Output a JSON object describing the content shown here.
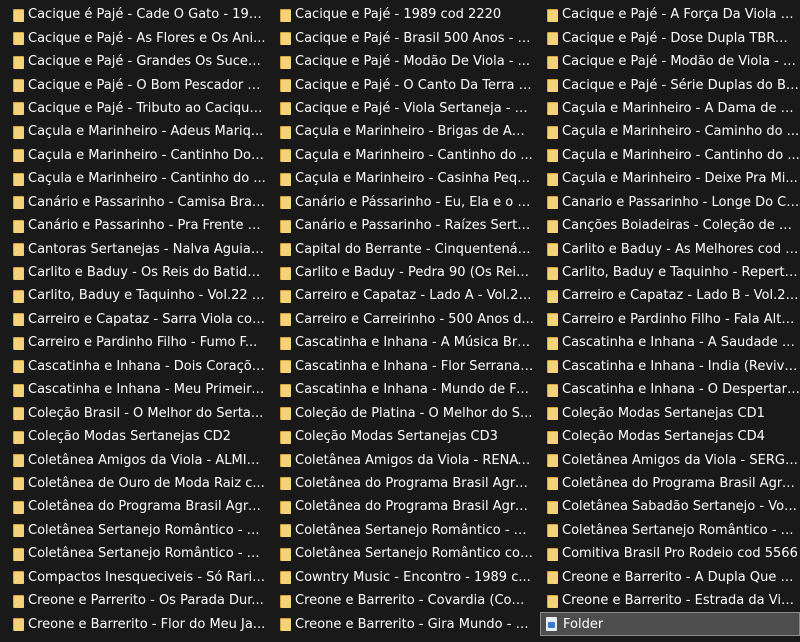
{
  "colors": {
    "background": "#191919",
    "text": "#ffffff",
    "folder": "#f4d27a",
    "selection": "#4d4d4d"
  },
  "folder_icon": "folder-icon",
  "items": [
    "Cacique é Pajé  - Cade O Gato - 198...",
    "Cacique e Pajé - 1989 cod 2220",
    "Cacique e Pajé - A Força Da Viola co...",
    "Cacique e Pajé - As Flores e Os Ani...",
    "Cacique e Pajé - Brasil 500 Anos - 2...",
    "Cacique e Pajé - Dose Dupla TBRW-...",
    "Cacique e Pajé - Grandes Os Sucess...",
    "Cacique e Pajé - Modão De Viola - ...",
    "Cacique e Pajé - Modão de Viola - V...",
    "Cacique e Pajé - O Bom Pescador co...",
    "Cacique e Pajé - O Canto Da Terra - ...",
    "Cacique e Pajé - Série Duplas do Br...",
    "Cacique e Pajé - Tributo ao Cacique ...",
    "Cacique e Pajé - Viola Sertaneja - V...",
    "Caçula e Marinheiro - A Dama de V...",
    "Caçula e Marinheiro - Adeus Mariq...",
    "Caçula e Marinheiro - Brigas de Am...",
    "Caçula e Marinheiro - Caminho do ...",
    "Caçula e Marinheiro - Cantinho Do ...",
    "Caçula e Marinheiro - Cantinho do ...",
    "Caçula e Marinheiro - Cantinho do ...",
    "Caçula e Marinheiro - Cantinho do ...",
    "Caçula e Marinheiro - Casinha Pequ...",
    "Caçula e Marinheiro - Deixe Pra Mi...",
    "Canário e Passarinho - Camisa Bran...",
    "Canário e Pássarinho - Eu, Ela e o G...",
    "Canario e Passarinho - Longe Do Ca...",
    "Canário e Passarinho - Pra Frente c...",
    "Canário e Passarinho - Raízes Serta...",
    "Canções Boiadeiras - Coleção de O...",
    "Cantoras Sertanejas - Nalva Aguiar,...",
    "Capital do Berrante - Cinquentenári...",
    "Carlito e Baduy - As Melhores cod 8...",
    "Carlito e Baduy - Os Reis do Batidã...",
    "Carlito e Baduy - Pedra 90 (Os Reis ...",
    "Carlito, Baduy e Taquinho - Repertó...",
    "Carlito, Baduy e Taquinho - Vol.22 (...",
    "Carreiro e Capataz - Lado A - Vol.2 ...",
    "Carreiro e Capataz - Lado B - Vol.2 ...",
    "Carreiro e Capataz - Sarra Viola cod...",
    "Carreiro e Carreirinho - 500 Anos d...",
    "Carreiro e Pardinho Filho - Fala Alto...",
    "Carreiro e Pardinho Filho - Fumo F...",
    "Cascatinha e Inhana - A Música Bra...",
    "Cascatinha e Inhana - A Saudade é ...",
    "Cascatinha e Inhana - Dois Coraçõe...",
    "Cascatinha e Inhana - Flor Serrana (...",
    "Cascatinha e Inhana - India (Revive...",
    "Cascatinha e Inhana - Meu Primeiro...",
    "Cascatinha e Inhana - Mundo de Fel...",
    "Cascatinha e Inhana - O Despertar ...",
    "Coleção Brasil - O Melhor do Serta...",
    "Coleção de Platina - O Melhor do S...",
    "Coleção Modas Sertanejas CD1",
    "Coleção Modas Sertanejas CD2",
    "Coleção Modas Sertanejas CD3",
    "Coleção Modas Sertanejas CD4",
    "Coletânea Amigos da Viola - ALMIR...",
    "Coletânea Amigos da Viola - RENAT...",
    "Coletânea Amigos da Viola - SÉRGI...",
    "Coletânea de Ouro de Moda Raiz c...",
    "Coletânea do Programa Brasil Agro...",
    "Coletânea do Programa Brasil Agro...",
    "Coletânea do Programa Brasil Agro...",
    "Coletânea do Programa Brasil Agro...",
    "Coletânea Sabadão Sertanejo - Vol...",
    "Coletânea Sertanejo Romântico - C...",
    "Coletânea Sertanejo Romântico - C...",
    "Coletânea Sertanejo Romântico - C...",
    "Coletânea Sertanejo Romântico - C...",
    "Coletânea Sertanejo Romântico cod...",
    "Comitiva Brasil Pro Rodeio cod 5566",
    "Compactos Inesqueciveis - Só Rarid...",
    "Cowntry Music - Encontro - 1989 c...",
    "Creone e  Barrerito - A Dupla Que C...",
    "Creone e  Parrerito - Os Parada Dur...",
    "Creone e Barrerito - Covardia (Com...",
    "Creone e Barrerito - Estrada da Vid...",
    "Creone e Barrerito - Flor do Meu Ja...",
    "Creone e Barrerito - Gira Mundo - 1..."
  ],
  "selected_item": {
    "label": "Folder",
    "icon": "file-type-icon"
  }
}
